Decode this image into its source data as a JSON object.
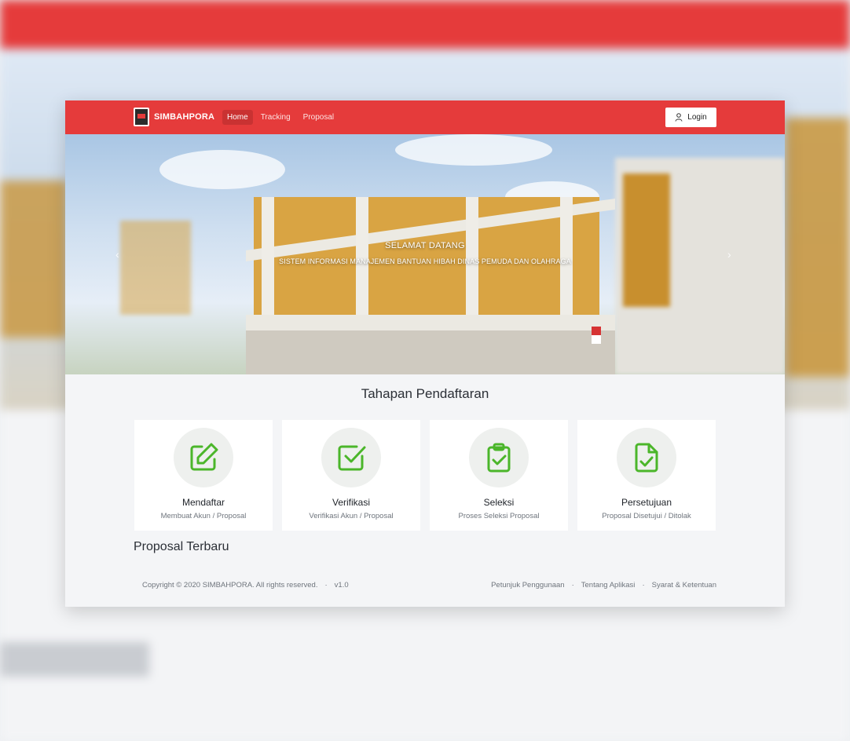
{
  "brand": {
    "name": "SIMBAHPORA"
  },
  "nav": {
    "items": [
      {
        "label": "Home",
        "active": true
      },
      {
        "label": "Tracking",
        "active": false
      },
      {
        "label": "Proposal",
        "active": false
      }
    ],
    "login_label": "Login"
  },
  "hero": {
    "title": "SELAMAT DATANG",
    "subtitle": "SISTEM INFORMASI MANAJEMEN BANTUAN HIBAH DINAS PEMUDA DAN OLAHRAGA",
    "prev_icon": "chevron-left-icon",
    "next_icon": "chevron-right-icon"
  },
  "steps": {
    "title": "Tahapan Pendaftaran",
    "items": [
      {
        "title": "Mendaftar",
        "subtitle": "Membuat Akun / Proposal",
        "icon": "edit-icon"
      },
      {
        "title": "Verifikasi",
        "subtitle": "Verifikasi Akun / Proposal",
        "icon": "check-square-icon"
      },
      {
        "title": "Seleksi",
        "subtitle": "Proses Seleksi Proposal",
        "icon": "clipboard-check-icon"
      },
      {
        "title": "Persetujuan",
        "subtitle": "Proposal Disetujui / Ditolak",
        "icon": "file-check-icon"
      }
    ]
  },
  "proposals": {
    "title": "Proposal Terbaru"
  },
  "footer": {
    "copyright": "Copyright © 2020 SIMBAHPORA. All rights reserved.",
    "version": "v1.0",
    "links": [
      "Petunjuk Penggunaan",
      "Tentang Aplikasi",
      "Syarat & Ketentuan"
    ]
  },
  "colors": {
    "primary": "#e53b3b",
    "icon": "#4bb62a"
  }
}
